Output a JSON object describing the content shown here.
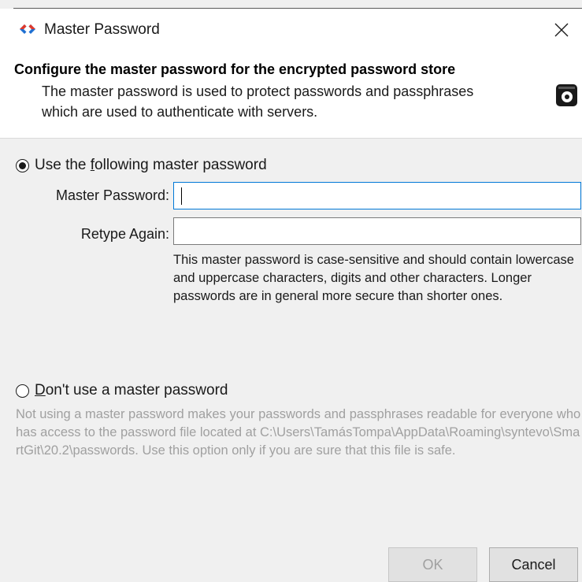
{
  "window": {
    "title": "Master Password",
    "close_glyph": "✕"
  },
  "header": {
    "title": "Configure the master password for the encrypted password store",
    "description": "The master password is used to protect passwords and passphrases which are used to authenticate with servers."
  },
  "options": {
    "use_password": {
      "label_before": "Use the ",
      "label_mnemonic": "f",
      "label_after": "ollowing master password",
      "selected": true
    },
    "master_password_label": "Master Password:",
    "master_password_value": "",
    "retype_label": "Retype Again:",
    "retype_value": "",
    "hint": "This master password is case-sensitive and should contain lowercase and uppercase characters, digits and other characters. Longer passwords are in general more secure than shorter ones.",
    "no_password": {
      "label_mnemonic": "D",
      "label_after": "on't use a master password",
      "selected": false
    },
    "no_password_note": "Not using a master password makes your passwords and passphrases readable for everyone who has access to the password file located at C:\\Users\\TamásTompa\\AppData\\Roaming\\syntevo\\SmartGit\\20.2\\passwords. Use this option only if you are sure that this file is safe."
  },
  "buttons": {
    "ok": "OK",
    "cancel": "Cancel"
  },
  "icons": {
    "app": "smartgit-diamond-icon",
    "close": "close-icon",
    "disk": "disk-icon"
  },
  "colors": {
    "app_icon": "#1f6fd1",
    "focus_border": "#0078d7",
    "disabled_text": "#a0a0a0"
  }
}
